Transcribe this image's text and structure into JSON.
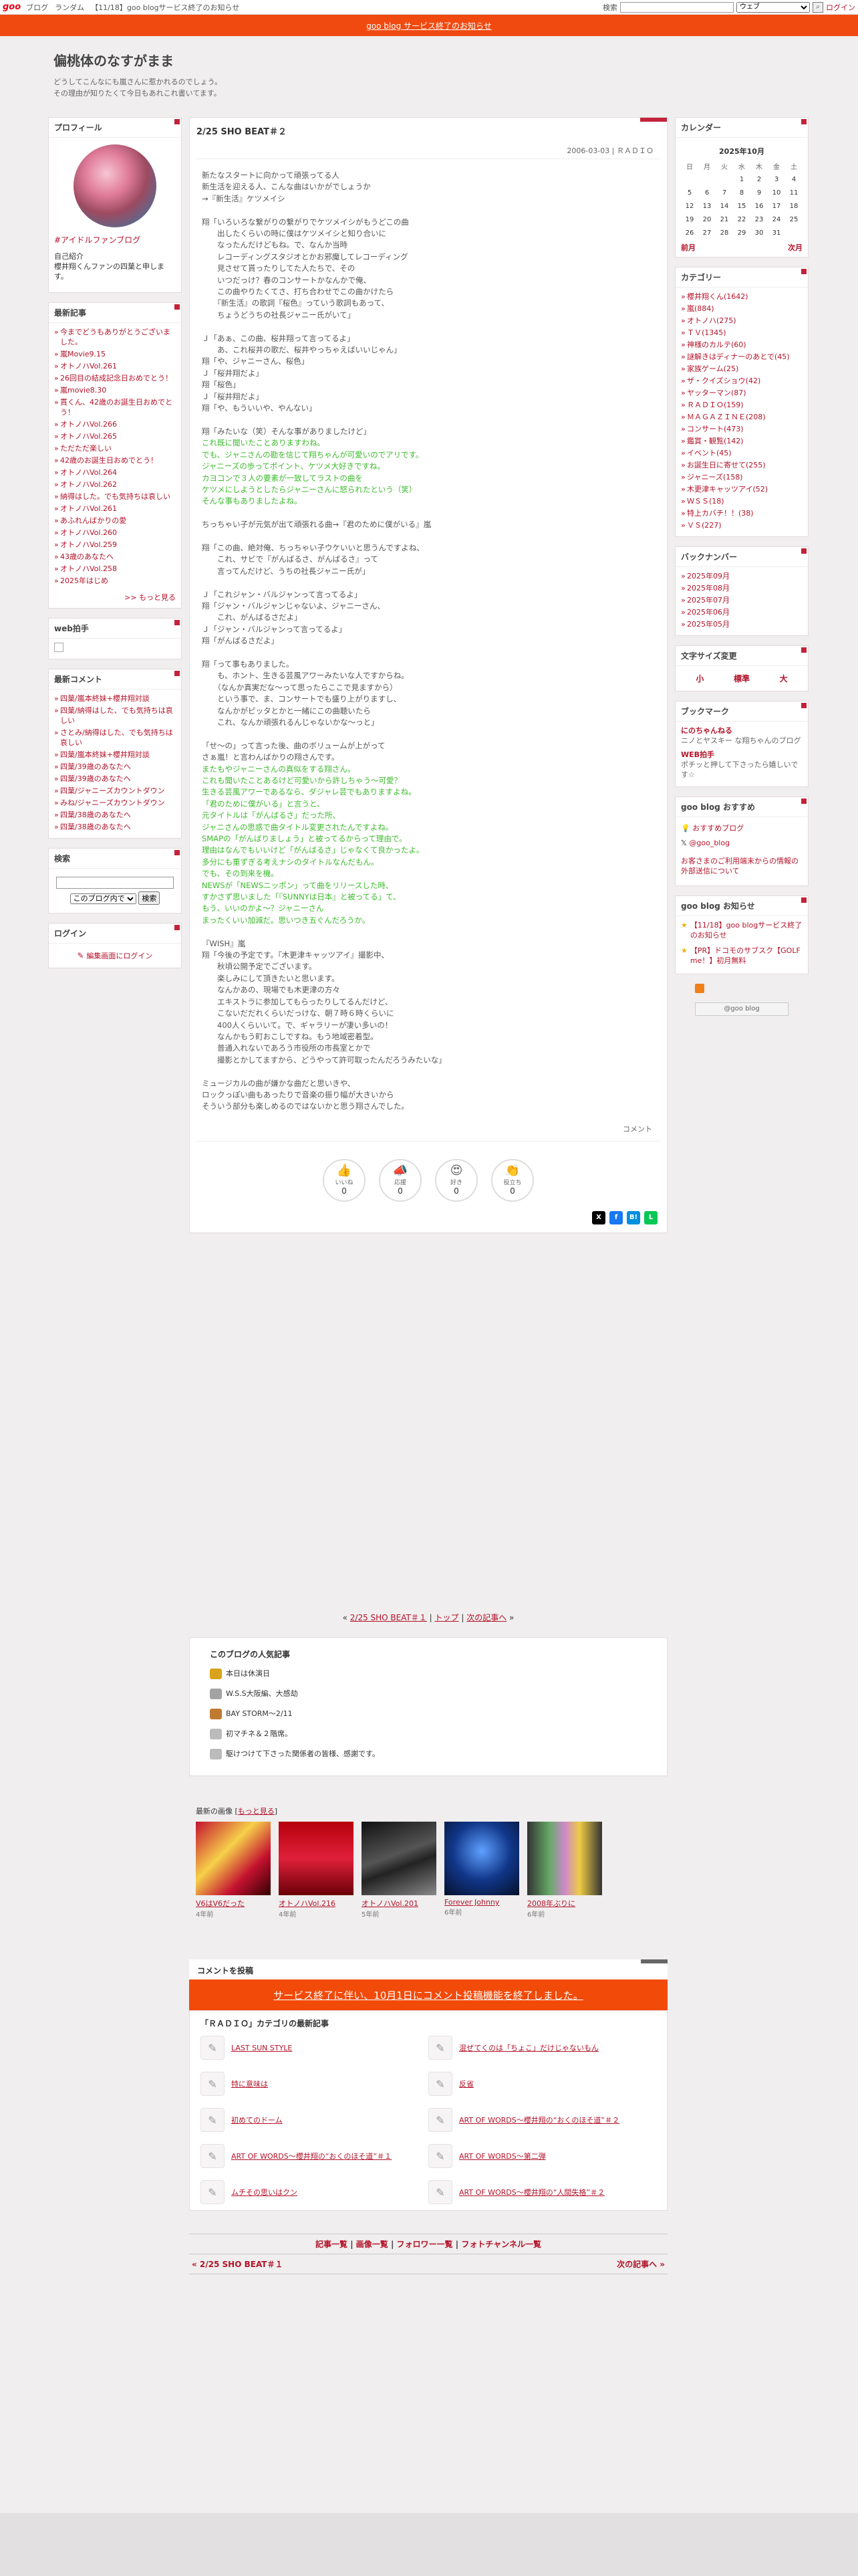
{
  "topbar": {
    "logo": "goo",
    "links": [
      "ブログ",
      "ランダム",
      "【11/18】goo blogサービス終了のお知らせ"
    ],
    "search_label": "検索",
    "search_scope": "ウェブ",
    "search_btn": "⌕",
    "login": "ログイン"
  },
  "notice": "goo blog サービス終了のお知らせ",
  "blog": {
    "title": "偏桃体のなすがまま",
    "desc1": "どうしてこんなにも嵐さんに惹かれるのでしょう。",
    "desc2": "その理由が知りたくて今日もあれこれ書いてます。"
  },
  "profile": {
    "heading": "プロフィール",
    "name": "#アイドルファンブログ",
    "self_label": "自己紹介",
    "self_text": "櫻井翔くんファンの四葉と申します。"
  },
  "recent": {
    "heading": "最新記事",
    "items": [
      "今までどうもありがとうございました。",
      "嵐Movie9.15",
      "オトノハVol.261",
      "26回目の結成記念日おめでとう！",
      "嵐movie8.30",
      "貫くん、42歳のお誕生日おめでとう！",
      "オトノハVol.266",
      "オトノハVol.265",
      "ただただ楽しい",
      "42歳のお誕生日おめでとう！",
      "オトノハVol.264",
      "オトノハVol.262",
      "納得はした。でも気持ちは哀しい",
      "オトノハVol.261",
      "あふれんばかりの愛",
      "オトノハVol.260",
      "オトノハVol.259",
      "43歳のあなたへ",
      "オトノハVol.258",
      "2025年はじめ"
    ],
    "more": ">> もっと見る"
  },
  "webclap": {
    "heading": "web拍手"
  },
  "comments": {
    "heading": "最新コメント",
    "items": [
      "四葉/嵐本終妹+櫻井翔対談",
      "四葉/納得はした、でも気持ちは哀しい",
      "さとみ/納得はした、でも気持ちは哀しい",
      "四葉/嵐本終妹+櫻井翔対談",
      "四葉/39歳のあなたへ",
      "四葉/39歳のあなたへ",
      "四葉/ジャニーズカウントダウン",
      "みね/ジャニーズカウントダウン",
      "四葉/38歳のあなたへ",
      "四葉/38歳のあなたへ"
    ]
  },
  "search": {
    "heading": "検索",
    "scope": "このブログ内で",
    "btn": "検索"
  },
  "login": {
    "heading": "ログイン",
    "link": "編集画面にログイン"
  },
  "calendar": {
    "heading": "カレンダー",
    "month": "2025年10月",
    "days": [
      "日",
      "月",
      "火",
      "水",
      "木",
      "金",
      "土"
    ],
    "weeks": [
      [
        "",
        "",
        "",
        "1",
        "2",
        "3",
        "4"
      ],
      [
        "5",
        "6",
        "7",
        "8",
        "9",
        "10",
        "11"
      ],
      [
        "12",
        "13",
        "14",
        "15",
        "16",
        "17",
        "18"
      ],
      [
        "19",
        "20",
        "21",
        "22",
        "23",
        "24",
        "25"
      ],
      [
        "26",
        "27",
        "28",
        "29",
        "30",
        "31",
        ""
      ]
    ],
    "prev": "前月",
    "next": "次月"
  },
  "categories": {
    "heading": "カテゴリー",
    "items": [
      "櫻井翔くん(1642)",
      "嵐(884)",
      "オトノハ(275)",
      "ＴＶ(1345)",
      "神様のカルテ(60)",
      "謎解きはディナーのあとで(45)",
      "家族ゲーム(25)",
      "ザ・クイズショウ(42)",
      "ヤッターマン(87)",
      "ＲＡＤＩＯ(159)",
      "ＭＡＧＡＺＩＮＥ(208)",
      "コンサート(473)",
      "鑑賞・観覧(142)",
      "イベント(45)",
      "お誕生日に寄せて(255)",
      "ジャニーズ(158)",
      "木更津キャッツアイ(52)",
      "ＷＳＳ(18)",
      "特上カバチ！！(38)",
      "ＶＳ(227)"
    ]
  },
  "backnumber": {
    "heading": "バックナンバー",
    "items": [
      "2025年09月",
      "2025年08月",
      "2025年07月",
      "2025年06月",
      "2025年05月"
    ]
  },
  "fontsize": {
    "heading": "文字サイズ変更",
    "small": "小",
    "normal": "標準",
    "large": "大"
  },
  "bookmark": {
    "heading": "ブックマーク",
    "items": [
      {
        "t": "にのちゃんねる",
        "d": "ニノとヤスキー な翔ちゃんのブログ"
      },
      {
        "t": "WEB拍手",
        "d": "ポチッと押して下さったら嬉しいです☆"
      }
    ]
  },
  "goo_recommend": {
    "heading": "goo blog おすすめ",
    "items": [
      "おすすめブログ",
      "@goo_blog"
    ],
    "note": "お客さまのご利用端末からの情報の外部送信について"
  },
  "goo_notice": {
    "heading": "goo blog お知らせ",
    "items": [
      "【11/18】goo blogサービス終了のお知らせ",
      "【PR】ドコモのサブスク【GOLF me！】初月無料"
    ],
    "badge": "@goo blog"
  },
  "entry": {
    "title": "2/25 SHO BEAT＃２",
    "meta": "2006-03-03 | ＲＡＤＩＯ",
    "comment_link": "コメント",
    "lines": [
      [
        "新たなスタートに向かって頑張ってる人",
        ""
      ],
      [
        "新生活を迎える人、こんな曲はいかがでしょうか",
        ""
      ],
      [
        "→『新生活』ケツメイシ",
        ""
      ],
      [
        "",
        ""
      ],
      [
        "翔「いろいろな繋がりの繋がりでケツメイシがもうどこの曲",
        ""
      ],
      [
        "　　出したくらいの時に僕はケツメイシと知り合いに",
        ""
      ],
      [
        "　　なったんだけどもね。で、なんか当時",
        ""
      ],
      [
        "　　レコーディングスタジオとかお邪魔してレコーディング",
        ""
      ],
      [
        "　　見させて貰ったりしてた人たちで、その",
        ""
      ],
      [
        "　　いつだっけ？春のコンサートかなんかで俺、",
        ""
      ],
      [
        "　　この曲やりたくてさ、打ち合わせでこの曲かけたら",
        ""
      ],
      [
        "　　『新生活』の歌詞『桜色』っていう歌詞もあって、",
        ""
      ],
      [
        "　　ちょうどうちの社長ジャニー氏がいて」",
        ""
      ],
      [
        "",
        ""
      ],
      [
        "Ｊ「あぁ、この曲、桜井翔って言ってるよ」",
        ""
      ],
      [
        "　　あ、これ桜井の歌だ、桜井やっちゃえばいいじゃん」",
        ""
      ],
      [
        "翔「や、ジャニーさん、桜色」",
        ""
      ],
      [
        "Ｊ「桜井翔だよ」",
        ""
      ],
      [
        "翔「桜色」",
        ""
      ],
      [
        "Ｊ「桜井翔だよ」",
        ""
      ],
      [
        "翔「や、もういいや、やんない」",
        ""
      ],
      [
        "",
        ""
      ],
      [
        "翔「みたいな（笑）そんな事がありましたけど」",
        ""
      ],
      [
        "これ既に聞いたことありますわね。",
        "g"
      ],
      [
        "でも、ジャニさんの勘を信じて翔ちゃんが可愛いのでアリです。",
        "g"
      ],
      [
        "ジャニーズの歩ってポイント、ケツメ大好きですね。",
        "g"
      ],
      [
        "カヨコンで３人の要素が一致してラストの曲を",
        "g"
      ],
      [
        "ケツメにしようとしたらジャニーさんに怒られたという（笑）",
        "g"
      ],
      [
        "そんな事もありましたよね。",
        "g"
      ],
      [
        "",
        ""
      ],
      [
        "ちっちゃい子が元気が出て頑張れる曲→『君のために僕がいる』嵐",
        ""
      ],
      [
        "",
        ""
      ],
      [
        "翔「この曲、絶対俺、ちっちゃい子ウケいいと思うんですよね、",
        ""
      ],
      [
        "　　これ、サビで『がんばるさ、がんばるさ』って",
        ""
      ],
      [
        "　　言ってんだけど、うちの社長ジャニー氏が」",
        ""
      ],
      [
        "",
        ""
      ],
      [
        "Ｊ「これジャン・バルジャンって言ってるよ」",
        ""
      ],
      [
        "翔「ジャン・バルジャンじゃないよ、ジャニーさん、",
        ""
      ],
      [
        "　　これ、がんばるさだよ」",
        ""
      ],
      [
        "Ｊ「ジャン・バルジャンって言ってるよ」",
        ""
      ],
      [
        "翔「がんばるさだよ」",
        ""
      ],
      [
        "",
        ""
      ],
      [
        "翔「って事もありました。",
        ""
      ],
      [
        "　　も、ホント、生きる芸風アワーみたいな人ですからね。",
        ""
      ],
      [
        "　　（なんか真実だな～って思ったらここで見ますから）",
        ""
      ],
      [
        "　　という事で、ま、コンサートでも盛り上がりますし、",
        ""
      ],
      [
        "　　なんかがピッタとかと一緒にこの曲聴いたら",
        ""
      ],
      [
        "　　これ、なんか頑張れるんじゃないかな～っと」",
        ""
      ],
      [
        "",
        ""
      ],
      [
        "「せ～の」って言った後、曲のボリュームが上がって",
        ""
      ],
      [
        "さぁ嵐！と言わんばかりの翔さんです。",
        ""
      ],
      [
        "またもやジャニーさんの真似をする翔さん。",
        "g"
      ],
      [
        "これも聞いたことあるけど可愛いから許しちゃう～可愛？",
        "g"
      ],
      [
        "生きる芸風アワーであるなら、ダジャレ芸でもありますよね。",
        "g"
      ],
      [
        "「君のために僕がいる」と言うと、",
        "g"
      ],
      [
        "元タイトルは「がんばるさ」だった所、",
        "g"
      ],
      [
        "ジャニさんの思惑で曲タイトル変更されたんですよね。",
        "g"
      ],
      [
        "SMAPの「がんばりましょう」と被ってるからって理由で。",
        "g"
      ],
      [
        "理由はなんでもいいけど「がんばるさ」じゃなくて良かったよ。",
        "g"
      ],
      [
        "多分にも重ずぎる考えナシのタイトルなんだもん。",
        "g"
      ],
      [
        "でも、その到来を機。",
        "g"
      ],
      [
        "NEWSが「NEWSニッポン」って曲をリリースした時、",
        "g"
      ],
      [
        "すかさず思いました「『SUNNYは日本』と被ってる」て、",
        "g"
      ],
      [
        "もう、いいのかよ～？ジャニーさん",
        "g"
      ],
      [
        "まったくいい加減だ。思いつき五ぐんだろうか。",
        "g"
      ],
      [
        "",
        ""
      ],
      [
        "『WISH』嵐",
        ""
      ],
      [
        "翔「今後の予定です。『木更津キャッツアイ』撮影中、",
        ""
      ],
      [
        "　　秋頃公開予定でございます。",
        ""
      ],
      [
        "　　楽しみにして頂きたいと思います。",
        ""
      ],
      [
        "　　なんかあの、現場でも木更津の方々",
        ""
      ],
      [
        "　　エキストラに参加してもらったりしてるんだけど、",
        ""
      ],
      [
        "　　こないだだれくらいだっけな、朝７時６時くらいに",
        ""
      ],
      [
        "　　400人くらいいて。で、ギャラリーが凄い多いの！",
        ""
      ],
      [
        "　　なんかもう町おこしですね。もう地域密着型。",
        ""
      ],
      [
        "　　普通入れないであろう市役所の市長室とかで",
        ""
      ],
      [
        "　　撮影とかしてますから、どうやって許可取ったんだろうみたいな」",
        ""
      ],
      [
        "",
        ""
      ],
      [
        "ミュージカルの曲が嫌かな曲だと思いきや、",
        ""
      ],
      [
        "ロックっぽい曲もあったりで音楽の振り幅が大きいから",
        ""
      ],
      [
        "そういう部分も楽しめるのではないかと思う翔さんでした。",
        ""
      ]
    ]
  },
  "reactions": [
    {
      "label": "いいね",
      "icon": "👍",
      "count": "0"
    },
    {
      "label": "応援",
      "icon": "📣",
      "count": "0"
    },
    {
      "label": "好き",
      "icon": "😍",
      "count": "0"
    },
    {
      "label": "役立ち",
      "icon": "👏",
      "count": "0"
    }
  ],
  "prevnext": {
    "prev": "2/25 SHO BEAT＃１",
    "top": "トップ",
    "next": "次の記事へ"
  },
  "popular": {
    "heading": "このブログの人気記事",
    "items": [
      "本日は休演日",
      "W.S.S大阪編、大感劫",
      "BAY STORM～2/11",
      "初マチネ＆２階席。",
      "駆けつけて下さった関係者の皆様、感謝です。"
    ]
  },
  "latest_images": {
    "heading": "最新の画像",
    "more": "もっと見る",
    "items": [
      {
        "t": "V6はV6だった",
        "tm": "4年前"
      },
      {
        "t": "オトノハVol.216",
        "tm": "4年前"
      },
      {
        "t": "オトノハVol.201",
        "tm": "5年前"
      },
      {
        "t": "Forever Johnny",
        "tm": "6年前"
      },
      {
        "t": "2008年ぶりに",
        "tm": "6年前"
      }
    ]
  },
  "comment_post": {
    "heading": "コメントを投稿",
    "notice": "サービス終了に伴い、10月1日にコメント投稿機能を終了しました。"
  },
  "related": {
    "heading": "「ＲＡＤＩＯ」カテゴリの最新記事",
    "items": [
      "LAST SUN STYLE",
      "混ぜてくのは「ちょこ」だけじゃないもん",
      "特に意味は",
      "反省",
      "初めてのドーム",
      "ART OF WORDS～櫻井翔の“おくのほそ道”＃２",
      "ART OF WORDS～櫻井翔の“おくのほそ道”＃１",
      "ART OF WORDS～第二弾",
      "ムチその思いはクン",
      "ART OF WORDS～櫻井翔の“人間失格”＃２"
    ]
  },
  "footer_links": {
    "items": [
      "記事一覧",
      "画像一覧",
      "フォロワー一覧",
      "フォトチャンネル一覧"
    ],
    "prev": "« 2/25 SHO BEAT＃１",
    "next": "次の記事へ »"
  }
}
